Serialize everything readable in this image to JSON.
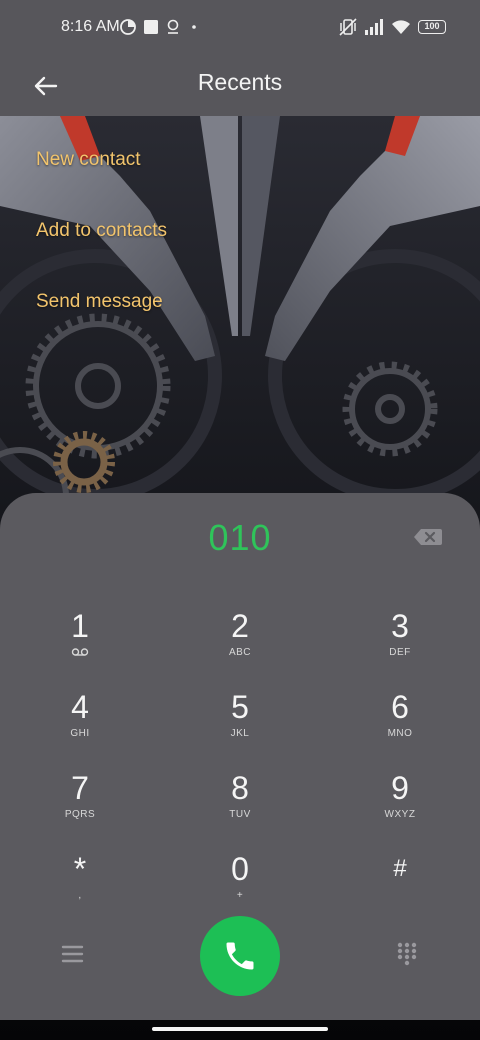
{
  "status_bar": {
    "time": "8:16 AM",
    "battery": "100",
    "icons": [
      "data-saver-icon",
      "square-icon",
      "location-icon",
      "dot-icon",
      "vibrate-icon",
      "signal-icon",
      "wifi-icon",
      "battery-icon"
    ]
  },
  "header": {
    "title": "Recents",
    "back_icon": "arrow-left-icon"
  },
  "menu": {
    "items": [
      {
        "label": "New contact"
      },
      {
        "label": "Add to contacts"
      },
      {
        "label": "Send message"
      }
    ]
  },
  "dialpad": {
    "number": "010",
    "keys": [
      {
        "digit": "1",
        "letters": ""
      },
      {
        "digit": "2",
        "letters": "ABC"
      },
      {
        "digit": "3",
        "letters": "DEF"
      },
      {
        "digit": "4",
        "letters": "GHI"
      },
      {
        "digit": "5",
        "letters": "JKL"
      },
      {
        "digit": "6",
        "letters": "MNO"
      },
      {
        "digit": "7",
        "letters": "PQRS"
      },
      {
        "digit": "8",
        "letters": "TUV"
      },
      {
        "digit": "9",
        "letters": "WXYZ"
      },
      {
        "digit": "*",
        "letters": ","
      },
      {
        "digit": "0",
        "letters": "+"
      },
      {
        "digit": "#",
        "letters": ""
      }
    ]
  },
  "colors": {
    "accent_green": "#1dbf55",
    "number_green": "#2fc45a",
    "menu_text": "#f2c46c",
    "panel": "#5b5a5f"
  }
}
